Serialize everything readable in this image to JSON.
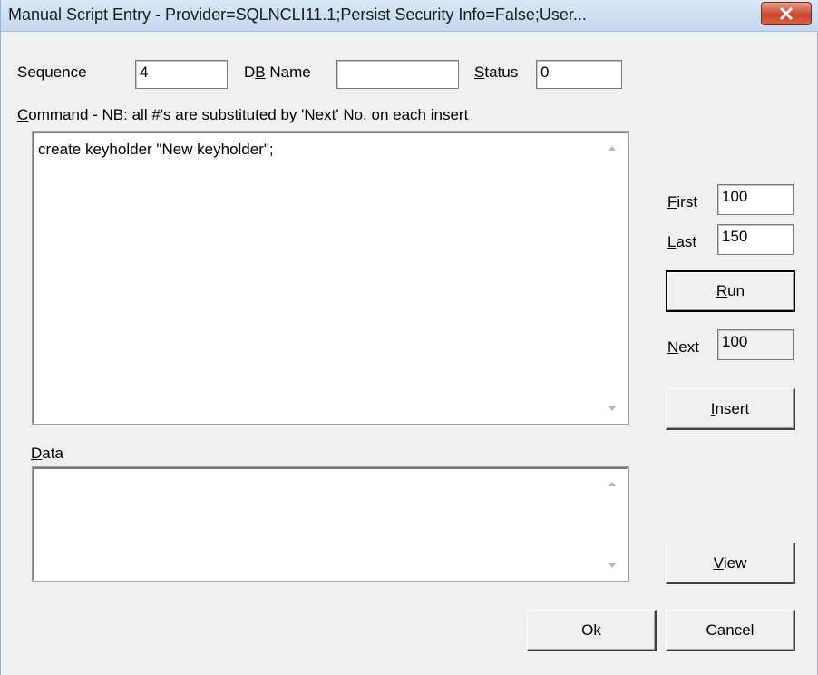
{
  "window": {
    "title": "Manual Script Entry - Provider=SQLNCLI11.1;Persist Security Info=False;User...",
    "close_icon": "close-icon"
  },
  "fields": {
    "sequence": {
      "label": "Sequence",
      "value": "4"
    },
    "db_name": {
      "label_pre": "D",
      "label_u": "B",
      "label_post": " Name",
      "value": ""
    },
    "status": {
      "label_u": "S",
      "label_post": "tatus",
      "value": "0"
    }
  },
  "command": {
    "label_u": "C",
    "label_post": "ommand - NB: all #'s are substituted by 'Next' No. on each insert",
    "text": "create keyholder \"New keyholder\";"
  },
  "data": {
    "label_u": "D",
    "label_post": "ata",
    "text": ""
  },
  "range": {
    "first": {
      "label_u": "F",
      "label_post": "irst",
      "value": "100"
    },
    "last": {
      "label_u": "L",
      "label_post": "ast",
      "value": "150"
    },
    "next": {
      "label_u": "N",
      "label_post": "ext",
      "value": "100"
    }
  },
  "buttons": {
    "run": {
      "u": "R",
      "post": "un"
    },
    "insert": {
      "u": "I",
      "post": "nsert"
    },
    "view": {
      "u": "V",
      "post": "iew"
    },
    "ok": "Ok",
    "cancel": "Cancel"
  }
}
